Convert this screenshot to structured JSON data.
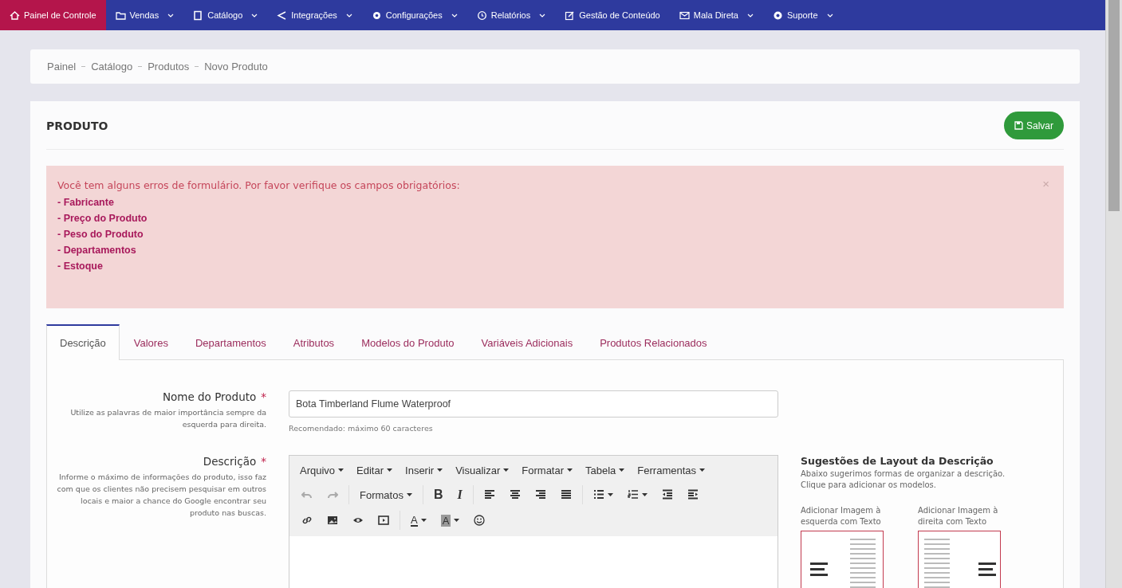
{
  "nav": [
    {
      "label": "Painel de Controle",
      "dropdown": false,
      "selected": true
    },
    {
      "label": "Vendas",
      "dropdown": true,
      "selected": false
    },
    {
      "label": "Catálogo",
      "dropdown": true,
      "selected": false
    },
    {
      "label": "Integrações",
      "dropdown": true,
      "selected": false
    },
    {
      "label": "Configurações",
      "dropdown": true,
      "selected": false
    },
    {
      "label": "Relatórios",
      "dropdown": true,
      "selected": false
    },
    {
      "label": "Gestão de Conteúdo",
      "dropdown": false,
      "selected": false
    },
    {
      "label": "Mala Direta",
      "dropdown": true,
      "selected": false
    },
    {
      "label": "Suporte",
      "dropdown": true,
      "selected": false
    }
  ],
  "breadcrumb": [
    "Painel",
    "Catálogo",
    "Produtos",
    "Novo Produto"
  ],
  "card": {
    "title": "PRODUTO",
    "save_button": "Salvar"
  },
  "alert": {
    "message": "Você tem alguns erros de formulário. Por favor verifique os campos obrigatórios:",
    "close": "×",
    "items": [
      "- Fabricante",
      "- Preço do Produto",
      "- Peso do Produto",
      "- Departamentos",
      "- Estoque"
    ]
  },
  "tabs": [
    {
      "label": "Descrição",
      "selected": true
    },
    {
      "label": "Valores",
      "selected": false
    },
    {
      "label": "Departamentos",
      "selected": false
    },
    {
      "label": "Atributos",
      "selected": false
    },
    {
      "label": "Modelos do Produto",
      "selected": false
    },
    {
      "label": "Variáveis Adicionais",
      "selected": false
    },
    {
      "label": "Produtos Relacionados",
      "selected": false
    }
  ],
  "name_field": {
    "label": "Nome do Produto",
    "required_mark": "*",
    "help": "Utilize as palavras de maior importância sempre da esquerda para direita.",
    "value": "Bota Timberland Flume Waterproof",
    "hint": "Recomendado: máximo 60 caracteres"
  },
  "description_field": {
    "label": "Descrição",
    "required_mark": "*",
    "help": "Informe o máximo de informações do produto, isso faz com que os clientes não precisem pesquisar em outros locais e maior a chance do Google encontrar seu produto nas buscas."
  },
  "editor": {
    "menu": [
      "Arquivo",
      "Editar",
      "Inserir",
      "Visualizar",
      "Formatar",
      "Tabela",
      "Ferramentas"
    ],
    "toolbar_rows": [
      {
        "groups": [
          {
            "items": [
              {
                "kind": "undo",
                "disabled": true,
                "dropdown": false
              },
              {
                "kind": "redo",
                "disabled": true,
                "dropdown": false
              }
            ]
          },
          {
            "items": [
              {
                "kind": "text",
                "label": "Formatos",
                "disabled": false,
                "dropdown": true
              }
            ]
          },
          {
            "items": [
              {
                "kind": "bold",
                "label": "B",
                "disabled": false,
                "dropdown": false
              },
              {
                "kind": "italic",
                "label": "I",
                "disabled": false,
                "dropdown": false
              }
            ]
          },
          {
            "items": [
              {
                "kind": "align-left",
                "disabled": false,
                "dropdown": false
              },
              {
                "kind": "align-center",
                "disabled": false,
                "dropdown": false
              },
              {
                "kind": "align-right",
                "disabled": false,
                "dropdown": false
              },
              {
                "kind": "align-justify",
                "disabled": false,
                "dropdown": false
              }
            ]
          },
          {
            "items": [
              {
                "kind": "bullet-list",
                "disabled": false,
                "dropdown": true
              },
              {
                "kind": "number-list",
                "disabled": false,
                "dropdown": true
              },
              {
                "kind": "outdent",
                "disabled": false,
                "dropdown": false
              },
              {
                "kind": "indent",
                "disabled": false,
                "dropdown": false
              }
            ]
          }
        ]
      },
      {
        "groups": [
          {
            "items": [
              {
                "kind": "link",
                "disabled": false,
                "dropdown": false
              },
              {
                "kind": "image",
                "disabled": false,
                "dropdown": false
              },
              {
                "kind": "preview",
                "disabled": false,
                "dropdown": false
              },
              {
                "kind": "media",
                "disabled": false,
                "dropdown": false
              }
            ]
          },
          {
            "items": [
              {
                "kind": "text-color",
                "label": "A",
                "disabled": false,
                "dropdown": true
              },
              {
                "kind": "background-color",
                "label": "A",
                "disabled": false,
                "dropdown": true
              },
              {
                "kind": "emoji",
                "disabled": false,
                "dropdown": false
              }
            ]
          }
        ]
      }
    ]
  },
  "suggestions": {
    "title": "Sugestões de Layout da Descrição",
    "text": "Abaixo sugerimos formas de organizar a descrição. Clique para adicionar os modelos.",
    "templates": [
      {
        "label": "Adicionar Imagem à esquerda com Texto",
        "kind": "image-left"
      },
      {
        "label": "Adicionar Imagem à direita com Texto",
        "kind": "image-right"
      }
    ]
  }
}
